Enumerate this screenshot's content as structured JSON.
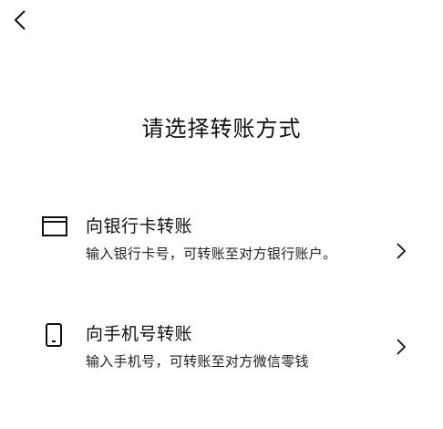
{
  "header": {
    "back_icon": "chevron-left-icon"
  },
  "title": "请选择转账方式",
  "options": [
    {
      "icon": "bank-card-icon",
      "title": "向银行卡转账",
      "description": "输入银行卡号，可转账至对方银行账户。",
      "chevron_icon": "chevron-right-icon"
    },
    {
      "icon": "mobile-phone-icon",
      "title": "向手机号转账",
      "description": "输入手机号，可转账至对方微信零钱",
      "chevron_icon": "chevron-right-icon"
    }
  ],
  "colors": {
    "background": "#ffffff",
    "text_primary": "#111111",
    "text_secondary": "#222222"
  }
}
